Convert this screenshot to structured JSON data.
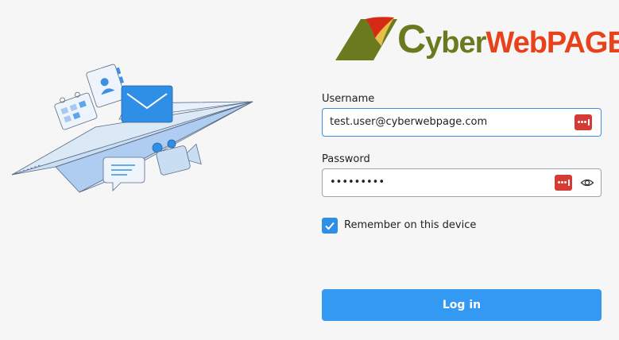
{
  "logo": {
    "brand_initial": "C",
    "brand_middle": "yber",
    "brand_end": "WebPAGE"
  },
  "form": {
    "username_label": "Username",
    "username_value": "test.user@cyberwebpage.com",
    "password_label": "Password",
    "password_masked_value": "•••••••••",
    "remember_label": "Remember on this device",
    "remember_checked": true,
    "login_label": "Log in"
  },
  "icons": {
    "password_manager": "password-manager-icon",
    "show_password": "eye-icon",
    "checkbox": "checkmark-icon"
  },
  "colors": {
    "accent": "#3399f3",
    "password_manager": "#d63a34",
    "logo_green": "#6b7a1e",
    "logo_red": "#e8421a"
  }
}
